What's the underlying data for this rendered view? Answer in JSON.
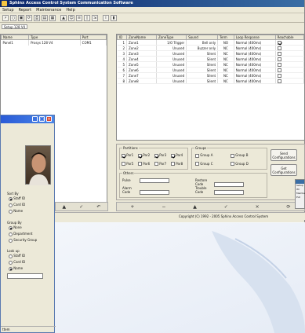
{
  "app": {
    "title": "Sphinx Access Control System Communication Software"
  },
  "menu": [
    "Setup",
    "Report",
    "Maintenance",
    "Help"
  ],
  "site_label": "Setup 128 V4",
  "left_table": {
    "headers": [
      "Name",
      "Type",
      "Port"
    ],
    "rows": [
      {
        "name": "Panel1",
        "type": "Prosys 128 V4",
        "port": "COM1"
      }
    ]
  },
  "zone_table": {
    "headers": [
      "ID",
      "ZoneName",
      "ZoneType",
      "Sound",
      "Term",
      "Loop Response",
      "Reachable"
    ],
    "rows": [
      {
        "id": "1",
        "name": "Zone1",
        "type": "1/O Trigger",
        "sound": "Bell only",
        "term": "NO",
        "loop": "Normal (400ms)",
        "reach": true
      },
      {
        "id": "2",
        "name": "Zone2",
        "type": "Unused",
        "sound": "Buzzer only",
        "term": "NC",
        "loop": "Normal (400ms)",
        "reach": false
      },
      {
        "id": "3",
        "name": "Zone3",
        "type": "Unused",
        "sound": "Silent",
        "term": "NC",
        "loop": "Normal (400ms)",
        "reach": false
      },
      {
        "id": "4",
        "name": "Zone4",
        "type": "Unused",
        "sound": "Silent",
        "term": "NC",
        "loop": "Normal (400ms)",
        "reach": false
      },
      {
        "id": "5",
        "name": "Zone5",
        "type": "Unused",
        "sound": "Silent",
        "term": "NC",
        "loop": "Normal (400ms)",
        "reach": false
      },
      {
        "id": "6",
        "name": "Zone6",
        "type": "Unused",
        "sound": "Silent",
        "term": "NC",
        "loop": "Normal (400ms)",
        "reach": false
      },
      {
        "id": "7",
        "name": "Zone7",
        "type": "Unused",
        "sound": "Silent",
        "term": "NC",
        "loop": "Normal (400ms)",
        "reach": false
      },
      {
        "id": "8",
        "name": "Zone8",
        "type": "Unused",
        "sound": "Silent",
        "term": "NC",
        "loop": "Normal (400ms)",
        "reach": false
      }
    ]
  },
  "partitions": {
    "title": "Partitions",
    "items": [
      {
        "label": "Par1",
        "checked": true
      },
      {
        "label": "Par2",
        "checked": true
      },
      {
        "label": "Par3",
        "checked": true
      },
      {
        "label": "Par4",
        "checked": true
      },
      {
        "label": "Par5",
        "checked": false
      },
      {
        "label": "Par6",
        "checked": false
      },
      {
        "label": "Par7",
        "checked": false
      },
      {
        "label": "Par8",
        "checked": false
      }
    ]
  },
  "groups": {
    "title": "Groups",
    "items": [
      "Group A",
      "Group B",
      "Group C",
      "Group D"
    ]
  },
  "others": {
    "title": "Others",
    "pulse": "Pulse",
    "alarm_code": "Alarm Code",
    "restore_code": "Restore Code",
    "trouble_code": "Trouble Code"
  },
  "buttons": {
    "send": "Send Configurations",
    "get": "Get Configurations"
  },
  "status": {
    "copyright": "Copyright (C) 1992 - 2005 Sphinx Access Control System"
  },
  "dialog": {
    "sort_by": "Sort By",
    "sort_opts": [
      "Staff ID",
      "Card ID",
      "Name"
    ],
    "group_by": "Group By",
    "group_opts": [
      "None",
      "Department",
      "Security Group"
    ],
    "look_up": "Look up",
    "look_opts": [
      "Staff ID",
      "Card ID",
      "Name"
    ],
    "footer": "ttem"
  },
  "sidebox": [
    "Setup",
    "Wr",
    "Member",
    "Put"
  ]
}
